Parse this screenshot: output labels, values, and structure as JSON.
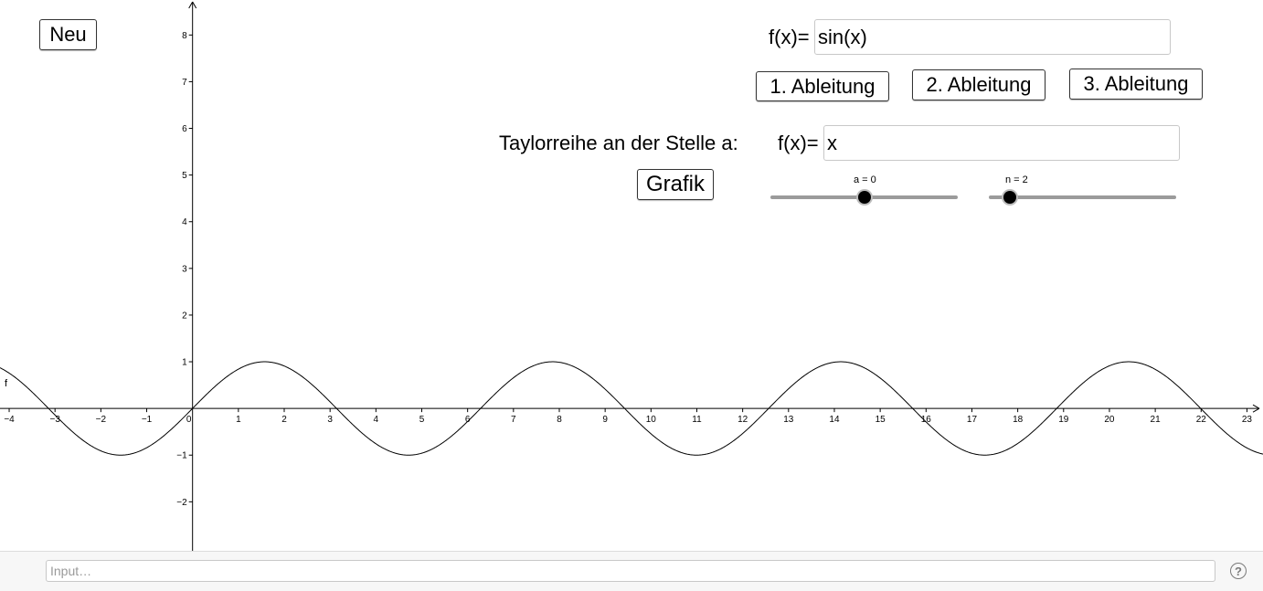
{
  "buttons": {
    "new": "Neu",
    "deriv1": "1. Ableitung",
    "deriv2": "2. Ableitung",
    "deriv3": "3. Ableitung",
    "graph": "Grafik"
  },
  "function_field": {
    "label": "f(x)=",
    "value": "sin(x)"
  },
  "taylor": {
    "caption": "Taylorreihe an der Stelle a:",
    "label": "f(x)=",
    "value": "x"
  },
  "sliders": [
    {
      "label": "a = 0",
      "min": -5,
      "max": 5,
      "value": 0
    },
    {
      "label": "n = 2",
      "min": 1,
      "max": 10,
      "value": 2
    }
  ],
  "input_bar": {
    "placeholder": "Input…",
    "help_icon": "question-mark-icon",
    "help_glyph": "?"
  },
  "chart_data": {
    "type": "line",
    "xlim": [
      -4.2,
      23.35
    ],
    "ylim": [
      -3.05,
      8.75
    ],
    "x_ticks": [
      "−4",
      "−3",
      "−2",
      "−1",
      "0",
      "1",
      "2",
      "3",
      "4",
      "5",
      "6",
      "7",
      "8",
      "9",
      "10",
      "11",
      "12",
      "13",
      "14",
      "15",
      "16",
      "17",
      "18",
      "19",
      "20",
      "21",
      "22",
      "23"
    ],
    "y_ticks": [
      "−2",
      "−1",
      "1",
      "2",
      "3",
      "4",
      "5",
      "6",
      "7",
      "8"
    ],
    "series": [
      {
        "name": "f",
        "expression": "sin(x)",
        "color": "#000000"
      }
    ],
    "grid": false
  }
}
